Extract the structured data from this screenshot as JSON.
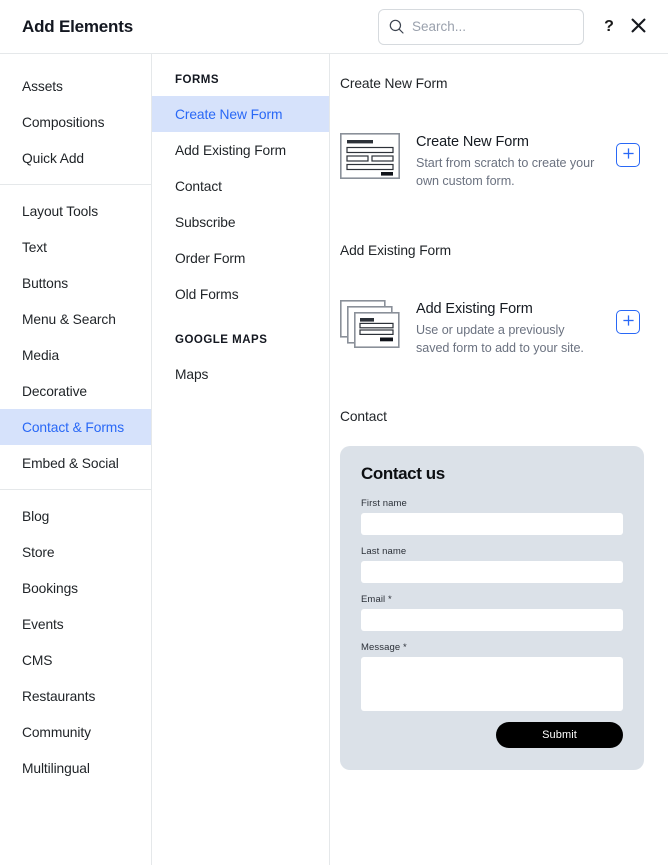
{
  "header": {
    "title": "Add Elements",
    "search": {
      "value": "",
      "placeholder": "Search..."
    },
    "help_label": "?",
    "close_label": "✕",
    "search_icon": "search-icon",
    "help_icon": "question-mark-icon",
    "close_icon": "close-icon"
  },
  "sidebar": {
    "groups": [
      {
        "items": [
          {
            "label": "Assets",
            "active": false
          },
          {
            "label": "Compositions",
            "active": false
          },
          {
            "label": "Quick Add",
            "active": false
          }
        ]
      },
      {
        "items": [
          {
            "label": "Layout Tools",
            "active": false
          },
          {
            "label": "Text",
            "active": false
          },
          {
            "label": "Buttons",
            "active": false
          },
          {
            "label": "Menu & Search",
            "active": false
          },
          {
            "label": "Media",
            "active": false
          },
          {
            "label": "Decorative",
            "active": false
          },
          {
            "label": "Contact & Forms",
            "active": true
          },
          {
            "label": "Embed & Social",
            "active": false
          }
        ]
      },
      {
        "items": [
          {
            "label": "Blog",
            "active": false
          },
          {
            "label": "Store",
            "active": false
          },
          {
            "label": "Bookings",
            "active": false
          },
          {
            "label": "Events",
            "active": false
          },
          {
            "label": "CMS",
            "active": false
          },
          {
            "label": "Restaurants",
            "active": false
          },
          {
            "label": "Community",
            "active": false
          },
          {
            "label": "Multilingual",
            "active": false
          }
        ]
      }
    ]
  },
  "midnav": {
    "sections": [
      {
        "header": "FORMS",
        "items": [
          {
            "label": "Create New Form",
            "active": true
          },
          {
            "label": "Add Existing Form",
            "active": false
          },
          {
            "label": "Contact",
            "active": false
          },
          {
            "label": "Subscribe",
            "active": false
          },
          {
            "label": "Order Form",
            "active": false
          },
          {
            "label": "Old Forms",
            "active": false
          }
        ]
      },
      {
        "header": "GOOGLE MAPS",
        "items": [
          {
            "label": "Maps",
            "active": false
          }
        ]
      }
    ]
  },
  "main": {
    "sections": [
      {
        "title": "Create New Form",
        "offer": {
          "name": "Create New Form",
          "description": "Start from scratch to create your own custom form.",
          "thumb_icon": "single-form-page-icon",
          "add_label": "+"
        }
      },
      {
        "title": "Add Existing Form",
        "offer": {
          "name": "Add Existing Form",
          "description": "Use or update a previously saved form to add to your site.",
          "thumb_icon": "stacked-form-pages-icon",
          "add_label": "+"
        }
      }
    ],
    "contact_section": {
      "title": "Contact",
      "preview": {
        "heading": "Contact us",
        "fields": [
          {
            "label": "First name",
            "type": "input",
            "value": ""
          },
          {
            "label": "Last name",
            "type": "input",
            "value": ""
          },
          {
            "label": "Email *",
            "type": "input",
            "value": ""
          },
          {
            "label": "Message *",
            "type": "textarea",
            "value": ""
          }
        ],
        "submit_label": "Submit"
      }
    },
    "next_section_title": ""
  },
  "colors": {
    "accent_blue": "#2968f6",
    "active_bg": "#d6e2fb",
    "card_bg": "#dbe1e8",
    "submit_bg": "#000000"
  }
}
